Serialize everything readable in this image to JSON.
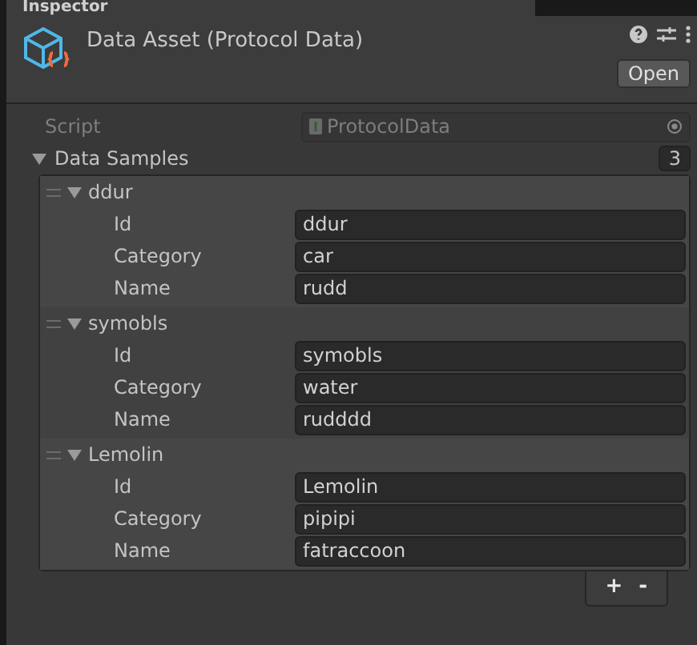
{
  "tab": {
    "title": "Inspector"
  },
  "header": {
    "title": "Data Asset (Protocol Data)",
    "open_button": "Open"
  },
  "script": {
    "label": "Script",
    "value": "ProtocolData",
    "disabled": true
  },
  "list": {
    "label": "Data Samples",
    "expanded": true,
    "count": "3",
    "items": [
      {
        "title": "ddur",
        "expanded": true,
        "fields": [
          {
            "label": "Id",
            "value": "ddur"
          },
          {
            "label": "Category",
            "value": "car"
          },
          {
            "label": "Name",
            "value": "rudd"
          }
        ]
      },
      {
        "title": "symobls",
        "expanded": true,
        "fields": [
          {
            "label": "Id",
            "value": "symobls"
          },
          {
            "label": "Category",
            "value": "water"
          },
          {
            "label": "Name",
            "value": "rudddd"
          }
        ]
      },
      {
        "title": "Lemolin",
        "expanded": true,
        "fields": [
          {
            "label": "Id",
            "value": "Lemolin"
          },
          {
            "label": "Category",
            "value": "pipipi"
          },
          {
            "label": "Name",
            "value": "fatraccoon"
          }
        ]
      }
    ],
    "add_button": "+",
    "remove_button": "-"
  }
}
